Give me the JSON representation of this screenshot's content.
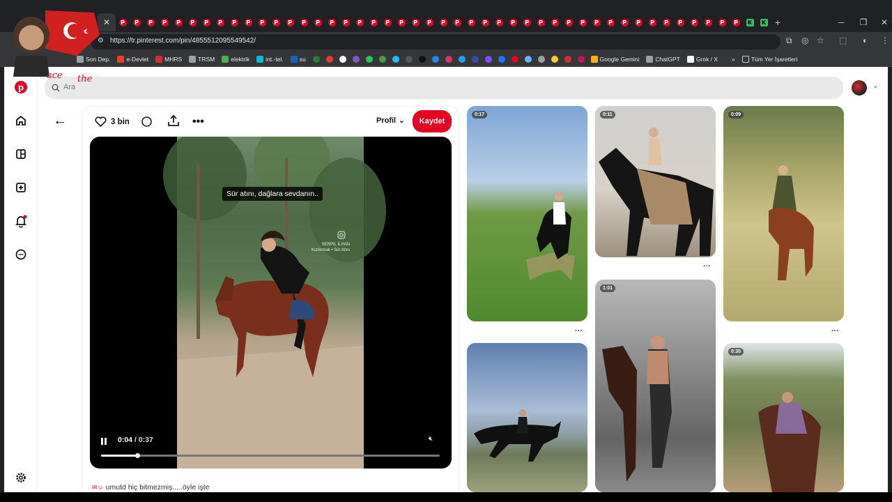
{
  "browser": {
    "url": "https://tr.pinterest.com/pin/4855512095549542/",
    "tab_count_pins": 45,
    "bookmarks": [
      {
        "label": "Son Dep.",
        "color": "#9aa0a6"
      },
      {
        "label": "e-Devlet",
        "color": "#e8412a"
      },
      {
        "label": "MHRS",
        "color": "#d32f2f"
      },
      {
        "label": "TRSM",
        "color": "#9aa0a6"
      },
      {
        "label": "elektrik",
        "color": "#4caf50"
      },
      {
        "label": "int.-tel.",
        "color": "#00bcd4"
      },
      {
        "label": "su",
        "color": "#1565c0"
      }
    ],
    "bookmarks_right": [
      {
        "label": "Google Gemini",
        "color": "#ffb300"
      },
      {
        "label": "ChatGPT",
        "color": "#9aa0a6"
      },
      {
        "label": "Grok / X",
        "color": "#ffffff"
      }
    ],
    "all_bookmarks_label": "Tüm Yer İşaretleri",
    "bookmarks_overflow": "»"
  },
  "search": {
    "placeholder": "Ara"
  },
  "pin": {
    "likes": "3 bin",
    "profile_label": "Profil",
    "save_label": "Kaydet",
    "video_caption": "Sür atını, dağlara sevdanın..",
    "watermark_line1": "SERPIL İLHAN",
    "watermark_line2": "Kızılırmak • Sür Atını",
    "time_current": "0:04",
    "time_separator": " / ",
    "time_total": "0:37",
    "progress": 0.108,
    "description": "umutd hiç bitmezmiş.....öyle işte"
  },
  "grid": [
    {
      "duration": "0:17"
    },
    {
      "duration": "0:11"
    },
    {
      "duration": "0:09"
    },
    {
      "duration": "1:01"
    },
    {
      "duration": "0:35"
    }
  ],
  "colors": {
    "accent": "#e60023",
    "search_bg": "#e9e9e9"
  }
}
